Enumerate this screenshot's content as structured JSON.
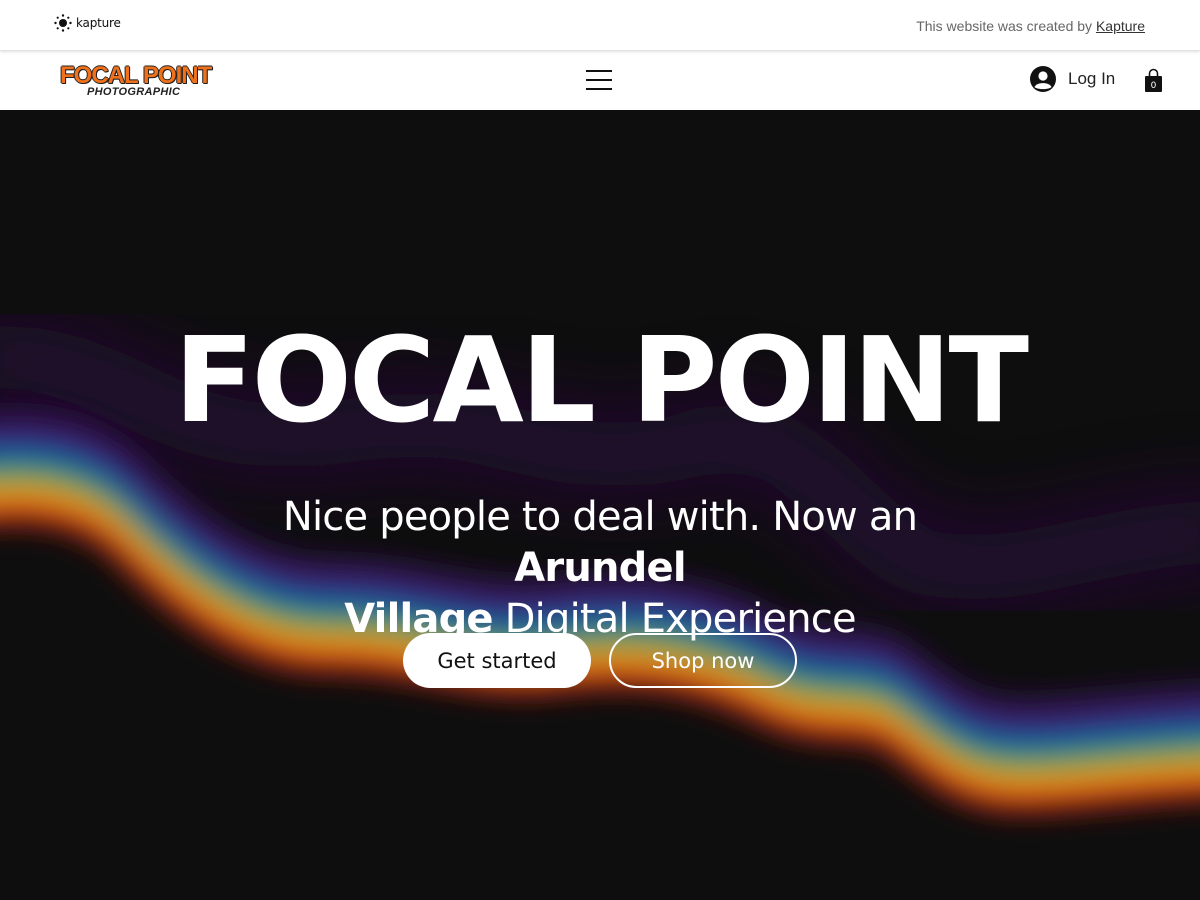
{
  "topbar": {
    "kapture_logo_text": "kapture",
    "credit_prefix": "This website was created by ",
    "credit_link": "Kapture"
  },
  "header": {
    "brand_main": "FOCAL POINT",
    "brand_sub": "PHOTOGRAPHIC",
    "login_label": "Log In",
    "cart_count": "0",
    "icons": [
      "sun-icon",
      "menu-icon",
      "user-avatar-icon",
      "shopping-bag-icon"
    ]
  },
  "hero": {
    "title": "FOCAL POINT",
    "subtitle_part1": "Nice people to deal with. Now an ",
    "subtitle_bold1": "Arundel",
    "subtitle_bold2": "Village",
    "subtitle_part2": " Digital Experience",
    "primary_button": "Get started",
    "secondary_button": "Shop now"
  },
  "colors": {
    "brand_orange": "#f0711c",
    "hero_background": "#0e0e0e",
    "button_white": "#ffffff"
  }
}
